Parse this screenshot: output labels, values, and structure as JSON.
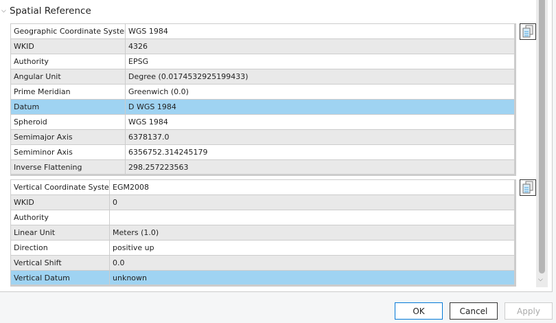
{
  "section": {
    "title": "Spatial Reference"
  },
  "geographic": [
    [
      "Geographic Coordinate System",
      "WGS 1984"
    ],
    [
      "WKID",
      "4326"
    ],
    [
      "Authority",
      "EPSG"
    ],
    [
      "Angular Unit",
      "Degree (0.0174532925199433)"
    ],
    [
      "Prime Meridian",
      "Greenwich (0.0)"
    ],
    [
      "Datum",
      "D WGS 1984"
    ],
    [
      "Spheroid",
      "WGS 1984"
    ],
    [
      "Semimajor Axis",
      "6378137.0"
    ],
    [
      "Semiminor Axis",
      "6356752.314245179"
    ],
    [
      "Inverse Flattening",
      "298.257223563"
    ]
  ],
  "vertical": [
    [
      "Vertical Coordinate System",
      "EGM2008"
    ],
    [
      "WKID",
      "0"
    ],
    [
      "Authority",
      ""
    ],
    [
      "Linear Unit",
      "Meters (1.0)"
    ],
    [
      "Direction",
      "positive up"
    ],
    [
      "Vertical Shift",
      "0.0"
    ],
    [
      "Vertical Datum",
      "unknown"
    ]
  ],
  "selected": {
    "geographic_row": 5,
    "vertical_row": 6
  },
  "buttons": {
    "ok": "OK",
    "cancel": "Cancel",
    "apply": "Apply"
  }
}
